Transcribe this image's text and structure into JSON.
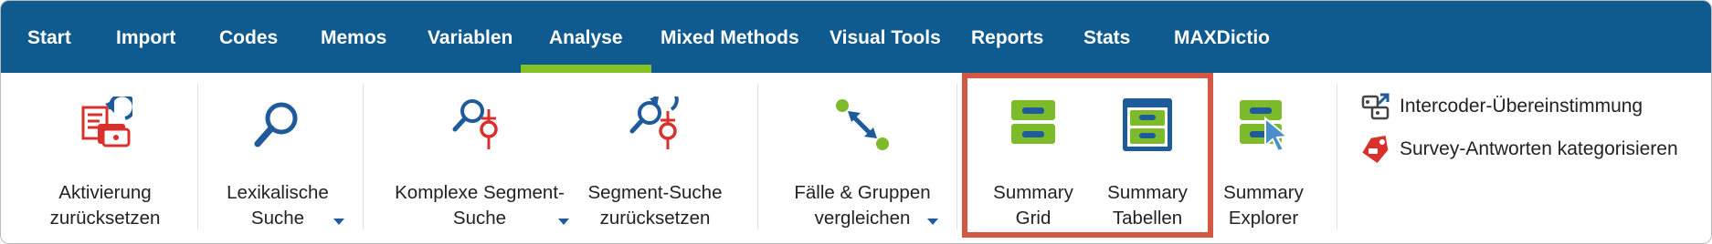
{
  "menu": {
    "tabs": [
      {
        "label": "Start"
      },
      {
        "label": "Import"
      },
      {
        "label": "Codes"
      },
      {
        "label": "Memos"
      },
      {
        "label": "Variablen"
      },
      {
        "label": "Analyse",
        "active": true
      },
      {
        "label": "Mixed Methods"
      },
      {
        "label": "Visual Tools"
      },
      {
        "label": "Reports"
      },
      {
        "label": "Stats"
      },
      {
        "label": "MAXDictio"
      }
    ]
  },
  "ribbon": {
    "aktivierung": {
      "line1": "Aktivierung",
      "line2": "zurücksetzen",
      "icon": "reset-activation-icon"
    },
    "lexikalische": {
      "line1": "Lexikalische",
      "line2": "Suche",
      "icon": "magnifier-icon"
    },
    "komplexe": {
      "line1": "Komplexe Segment-",
      "line2": "Suche",
      "icon": "complex-segment-search-icon"
    },
    "segment_reset": {
      "line1": "Segment-Suche",
      "line2": "zurücksetzen",
      "icon": "segment-search-reset-icon"
    },
    "faelle": {
      "line1": "Fälle & Gruppen",
      "line2": "vergleichen",
      "icon": "compare-arrows-icon"
    },
    "summary_grid": {
      "line1": "Summary",
      "line2": "Grid",
      "icon": "summary-grid-icon"
    },
    "summary_tabellen": {
      "line1": "Summary",
      "line2": "Tabellen",
      "icon": "summary-tables-icon"
    },
    "summary_explorer": {
      "line1": "Summary",
      "line2": "Explorer",
      "icon": "summary-explorer-icon"
    },
    "intercoder": {
      "label": "Intercoder-Übereinstimmung",
      "icon": "intercoder-icon"
    },
    "survey": {
      "label": "Survey-Antworten kategorisieren",
      "icon": "survey-tag-icon"
    }
  },
  "colors": {
    "menubar": "#0f5a8e",
    "active_underline": "#84c225",
    "highlight_box": "#d35843",
    "icon_blue": "#1f5a9a",
    "icon_green": "#7dbb2b",
    "icon_red": "#d9302c"
  }
}
